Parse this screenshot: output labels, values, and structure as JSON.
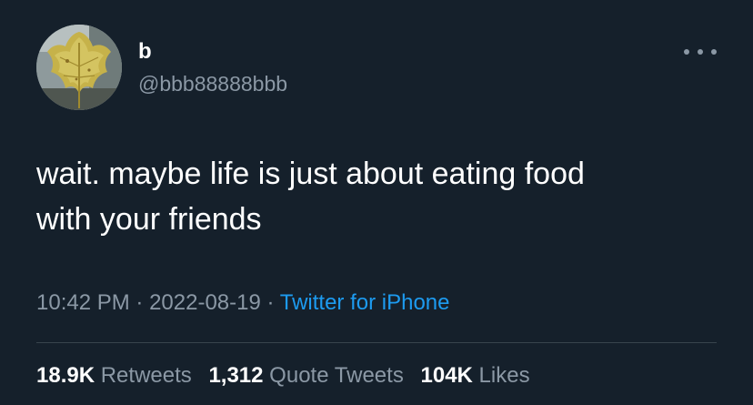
{
  "tweet": {
    "author": {
      "display_name": "b",
      "handle": "@bbb88888bbb",
      "avatar_icon": "leaf-avatar-photo"
    },
    "more_icon": "more-horizontal-icon",
    "text": "wait. maybe life is just about eating food\nwith your friends",
    "time": "10:42 PM",
    "date": "2022-08-19",
    "separator": "·",
    "source": "Twitter for iPhone",
    "stats": {
      "retweets_count": "18.9K",
      "retweets_label": "Retweets",
      "quotes_count": "1,312",
      "quotes_label": "Quote Tweets",
      "likes_count": "104K",
      "likes_label": "Likes"
    }
  },
  "colors": {
    "background": "#15202b",
    "primary_text": "#ffffff",
    "secondary_text": "#8b98a5",
    "link": "#1d9bf0",
    "divider": "#38444d"
  }
}
